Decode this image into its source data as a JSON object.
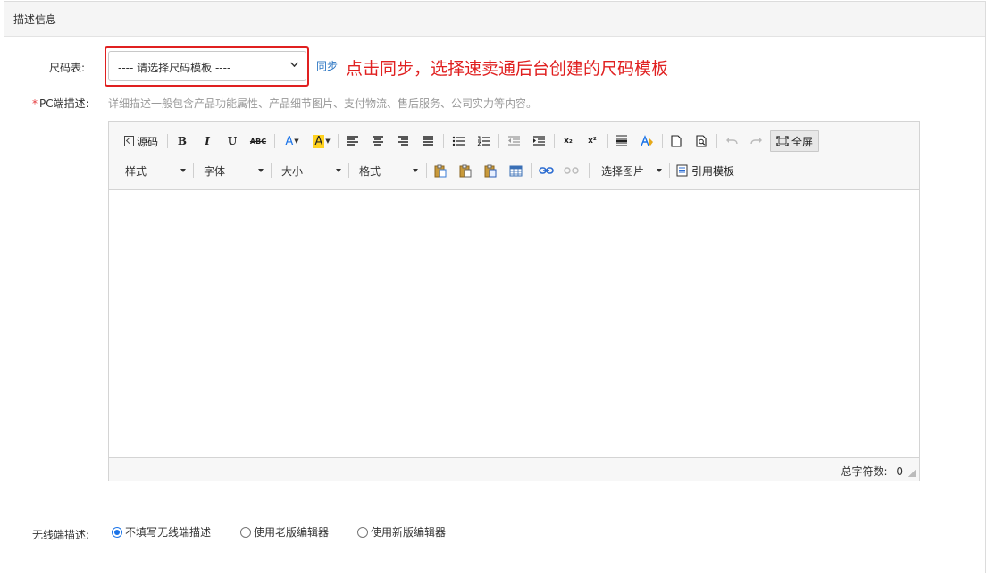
{
  "panel": {
    "title": "描述信息"
  },
  "size_chart": {
    "label": "尺码表:",
    "selected": "---- 请选择尺码模板 ----",
    "sync_label": "同步",
    "annotation": "点击同步，选择速卖通后台创建的尺码模板"
  },
  "pc_desc": {
    "required_mark": "*",
    "label": "PC端描述:",
    "hint": "详细描述一般包含产品功能属性、产品细节图片、支付物流、售后服务、公司实力等内容。"
  },
  "editor": {
    "toolbar": {
      "source_label": "源码",
      "fullscreen_label": "全屏",
      "style_dropdown": "样式",
      "font_dropdown": "字体",
      "size_dropdown": "大小",
      "format_dropdown": "格式",
      "image_dropdown": "选择图片",
      "template_label": "引用模板",
      "bold": "B",
      "italic": "I",
      "underline": "U",
      "strike": "ABC",
      "font_color": "A",
      "bg_color": "A",
      "subscript": "x₂",
      "superscript": "x²"
    },
    "status": {
      "char_count_label": "总字符数:",
      "char_count": "0"
    }
  },
  "wireless_desc": {
    "label": "无线端描述:",
    "options": [
      {
        "label": "不填写无线端描述",
        "checked": true
      },
      {
        "label": "使用老版编辑器",
        "checked": false
      },
      {
        "label": "使用新版编辑器",
        "checked": false
      }
    ]
  },
  "colors": {
    "accent": "#1a73e8",
    "annotation_red": "#e02020",
    "link": "#2f78c4",
    "required": "#e4393c"
  }
}
